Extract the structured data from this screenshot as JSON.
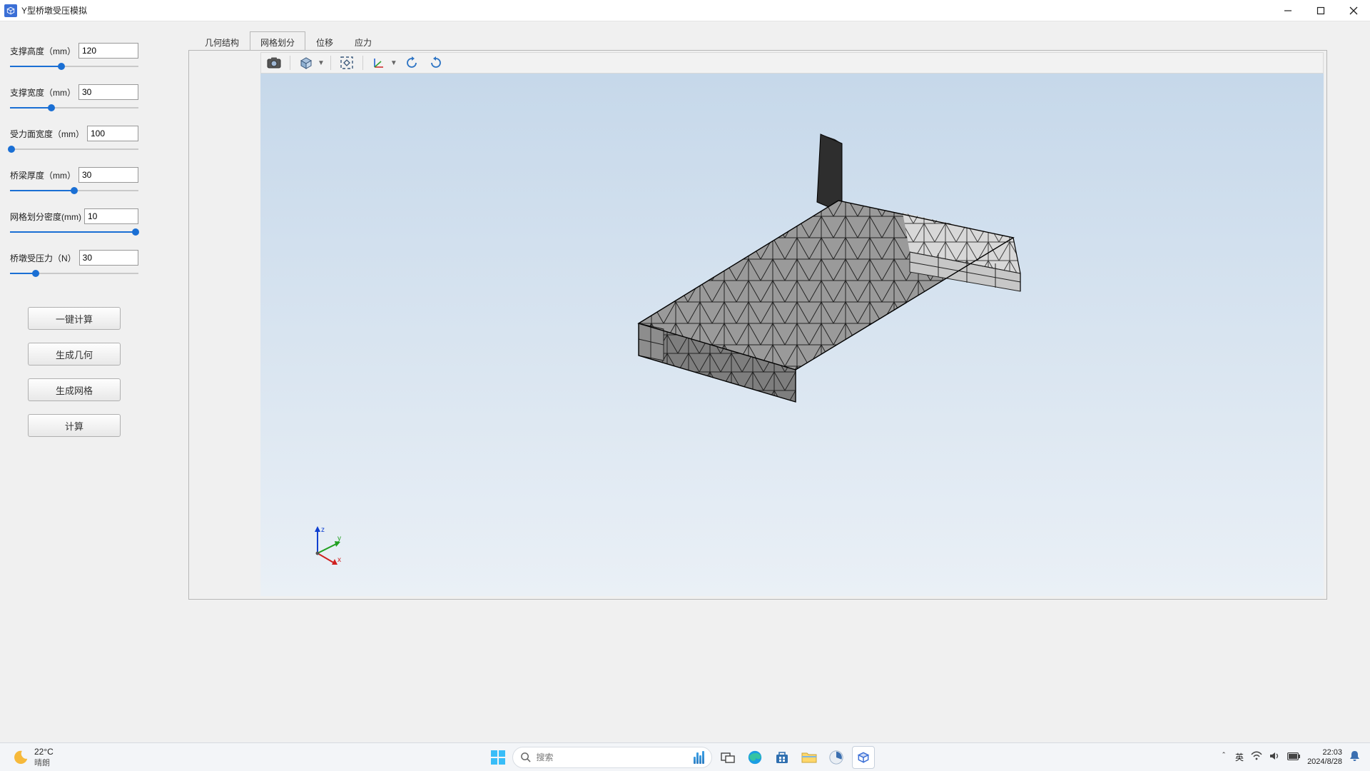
{
  "titlebar": {
    "title": "Y型桥墩受压模拟"
  },
  "params": [
    {
      "label": "支撑高度（mm）",
      "value": "120",
      "fill": 40
    },
    {
      "label": "支撑宽度（mm）",
      "value": "30",
      "fill": 32
    },
    {
      "label": "受力面宽度（mm）",
      "value": "100",
      "fill": 1
    },
    {
      "label": "桥梁厚度（mm）",
      "value": "30",
      "fill": 50
    },
    {
      "label": "网格划分密度(mm)",
      "value": "10",
      "fill": 98
    },
    {
      "label": "桥墩受压力（N）",
      "value": "30",
      "fill": 20
    }
  ],
  "buttons": {
    "compute_all": "一键计算",
    "gen_geometry": "生成几何",
    "gen_mesh": "生成网格",
    "compute": "计算"
  },
  "tabs": [
    {
      "id": "geometry",
      "label": "几何结构",
      "active": false
    },
    {
      "id": "mesh",
      "label": "网格划分",
      "active": true
    },
    {
      "id": "disp",
      "label": "位移",
      "active": false
    },
    {
      "id": "stress",
      "label": "应力",
      "active": false
    }
  ],
  "axis": {
    "x": "x",
    "y": "y",
    "z": "z"
  },
  "taskbar": {
    "weather_temp": "22°C",
    "weather_cond": "晴朗",
    "search_placeholder": "搜索",
    "ime": "英",
    "time": "22:03",
    "date": "2024/8/28"
  },
  "tray_chevron": "＾"
}
